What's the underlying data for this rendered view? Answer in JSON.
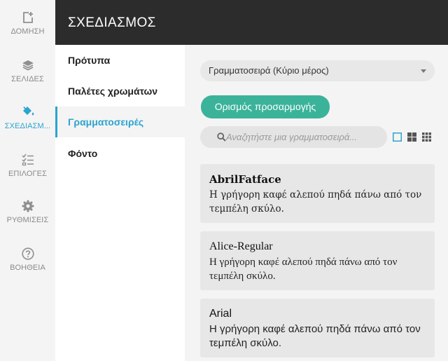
{
  "rail": {
    "items": [
      {
        "label": "ΔΟΜΗΣΗ",
        "icon": "plus-square-icon"
      },
      {
        "label": "ΣΕΛΙΔΕΣ",
        "icon": "layers-icon"
      },
      {
        "label": "ΣΧΕΔΙΑΣΜ...",
        "icon": "paint-bucket-icon",
        "active": true
      },
      {
        "label": "ΕΠΙΛΟΓΕΣ",
        "icon": "checklist-icon"
      },
      {
        "label": "ΡΥΘΜΙΣΕΙΣ",
        "icon": "gear-icon"
      },
      {
        "label": "ΒΟΗΘΕΙΑ",
        "icon": "help-circle-icon"
      }
    ]
  },
  "header": {
    "title": "ΣΧΕΔΙΑΣΜΟΣ"
  },
  "subnav": {
    "items": [
      {
        "label": "Πρότυπα"
      },
      {
        "label": "Παλέτες χρωμάτων"
      },
      {
        "label": "Γραμματοσειρές",
        "active": true
      },
      {
        "label": "Φόντο"
      }
    ]
  },
  "main": {
    "font_select": {
      "value": "Γραμματοσειρά (Κύριο μέρος)"
    },
    "custom_button": {
      "label": "Ορισμός προσαρμογής"
    },
    "search": {
      "placeholder": "Αναζητήστε μια γραμματοσειρά...",
      "value": ""
    },
    "fonts": [
      {
        "name": "AbrilFatface",
        "sample": "Η γρήγορη καφέ αλεπού πηδά πάνω από τον τεμπέλη σκύλο."
      },
      {
        "name": "Alice-Regular",
        "sample": "Η γρήγορη καφέ αλεπού πηδά πάνω από τον τεμπέλη σκύλο."
      },
      {
        "name": "Arial",
        "sample": "Η γρήγορη καφέ αλεπού πηδά πάνω από τον τεμπέλη σκύλο."
      }
    ]
  },
  "colors": {
    "accent": "#2ba4cf",
    "button": "#3bb39a",
    "topbar": "#2c2c2c"
  }
}
